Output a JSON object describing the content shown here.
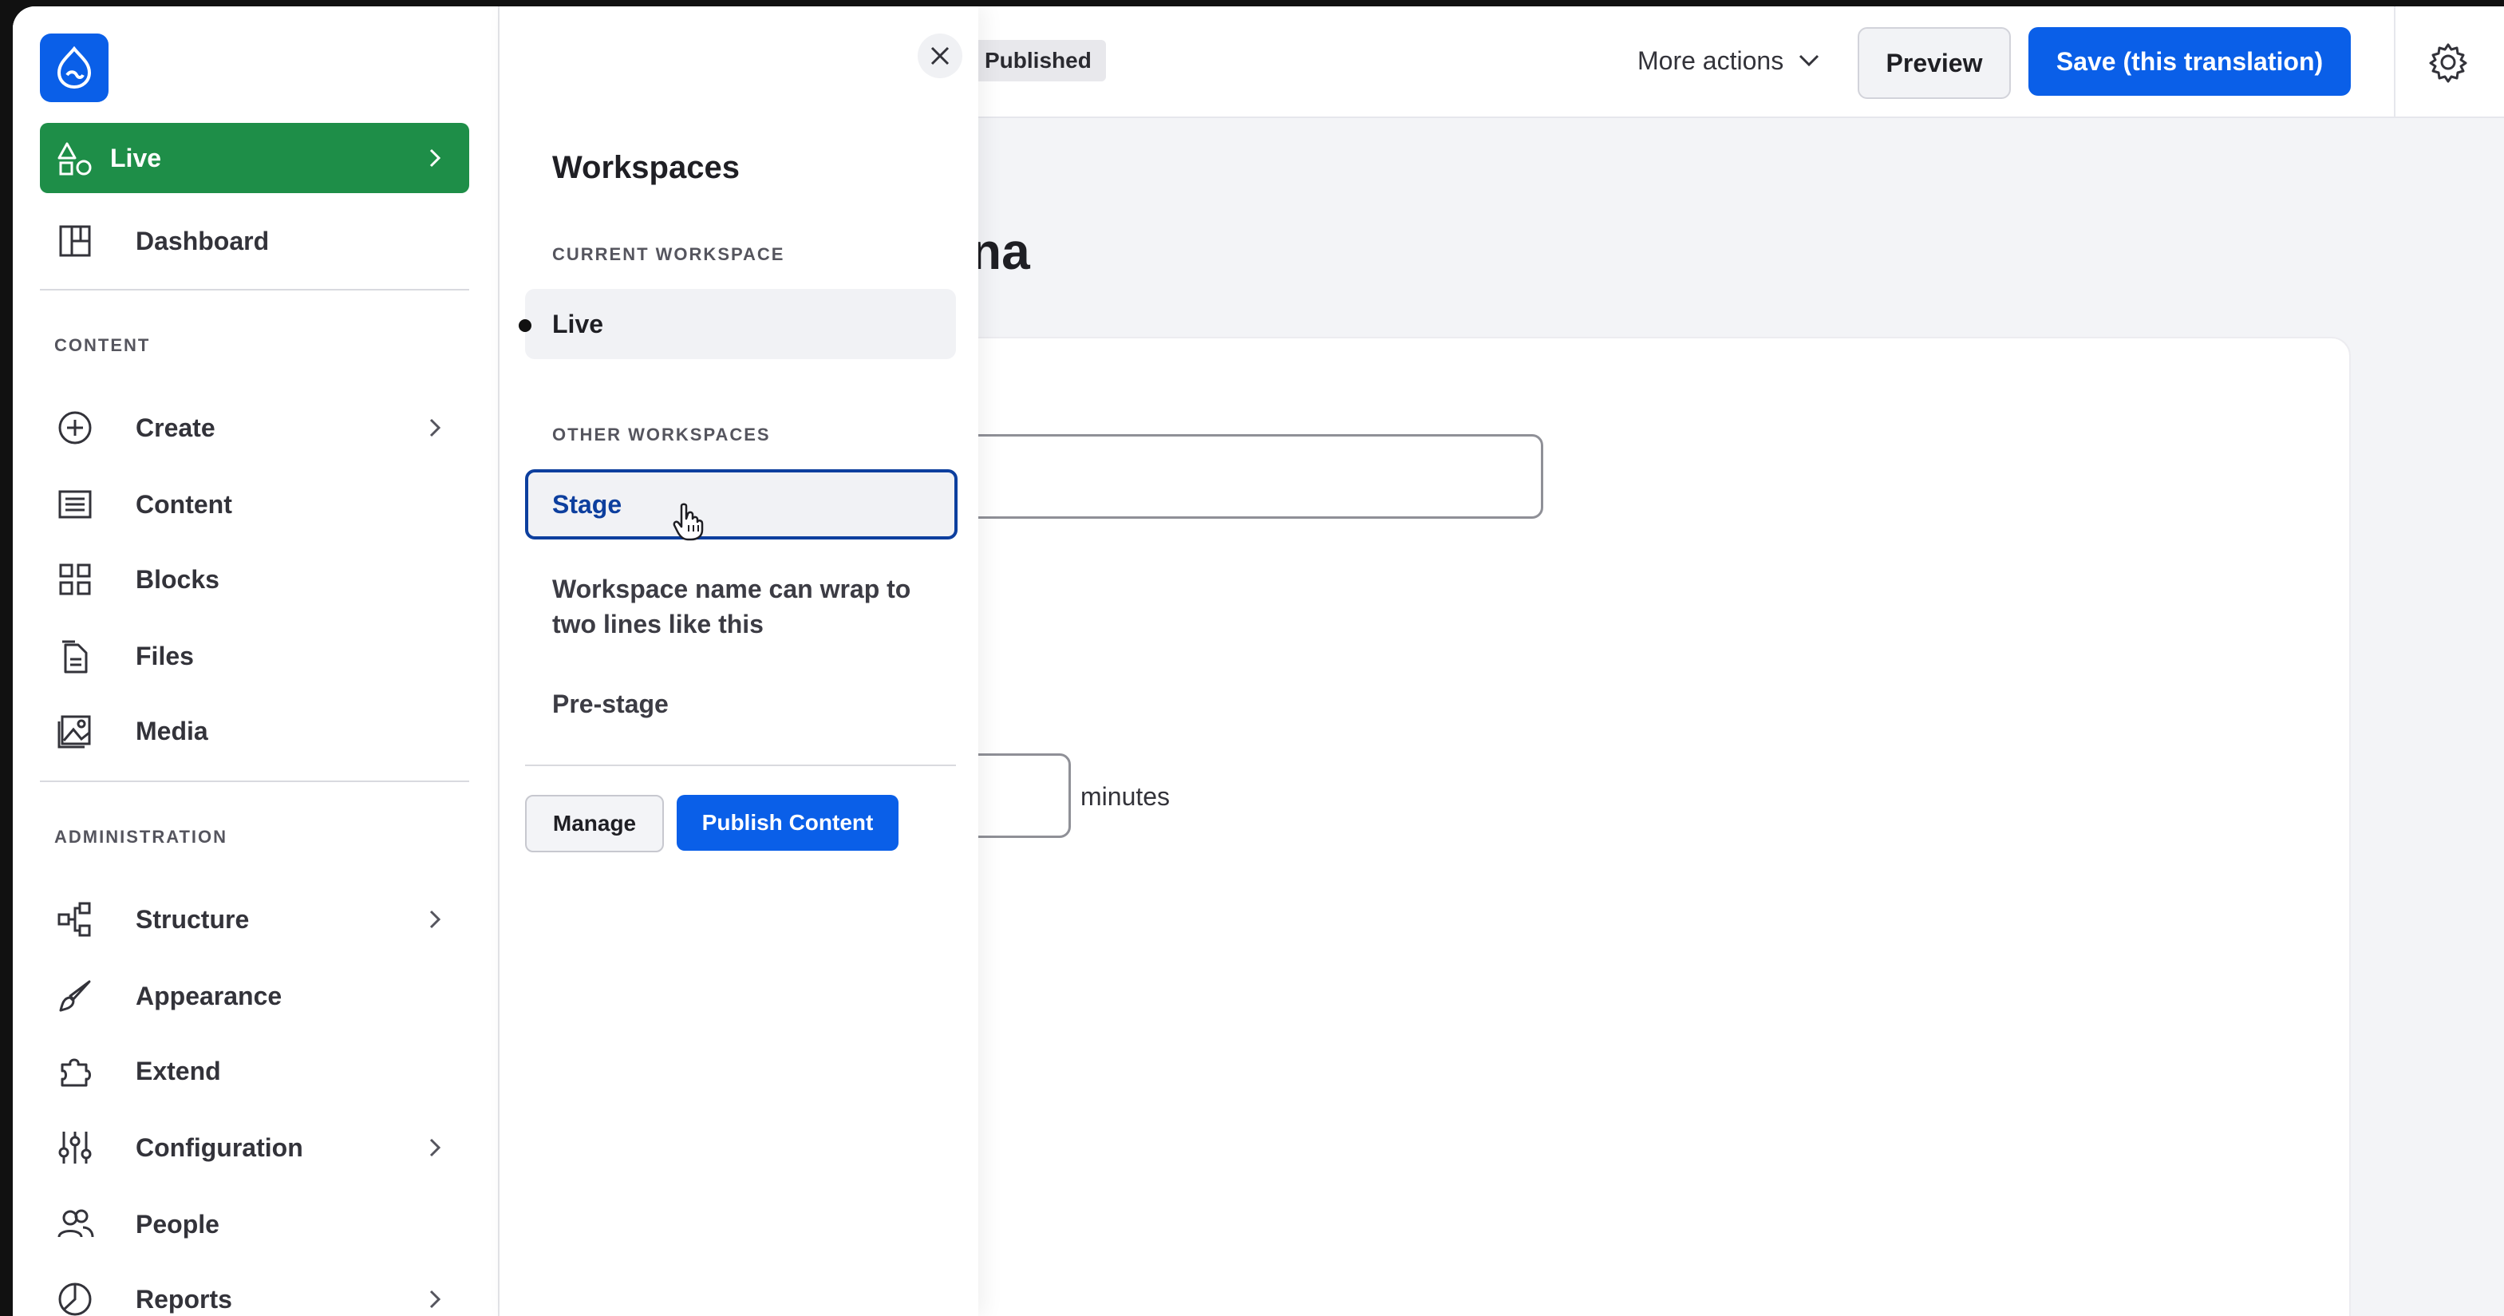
{
  "toolbar": {
    "status_badge": "Published",
    "more_actions": "More actions",
    "preview": "Preview",
    "save": "Save (this translation)"
  },
  "main": {
    "title_fragment": "na",
    "field_suffix": "minutes"
  },
  "sidebar": {
    "workspace_button": "Live",
    "dashboard": "Dashboard",
    "content_section": "CONTENT",
    "admin_section": "ADMINISTRATION",
    "content_items": [
      {
        "label": "Create",
        "icon": "plus-circle-icon",
        "has_submenu": true
      },
      {
        "label": "Content",
        "icon": "content-list-icon",
        "has_submenu": false
      },
      {
        "label": "Blocks",
        "icon": "blocks-grid-icon",
        "has_submenu": false
      },
      {
        "label": "Files",
        "icon": "file-icon",
        "has_submenu": false
      },
      {
        "label": "Media",
        "icon": "media-image-icon",
        "has_submenu": false
      }
    ],
    "admin_items": [
      {
        "label": "Structure",
        "icon": "structure-icon",
        "has_submenu": true
      },
      {
        "label": "Appearance",
        "icon": "paintbrush-icon",
        "has_submenu": false
      },
      {
        "label": "Extend",
        "icon": "puzzle-icon",
        "has_submenu": false
      },
      {
        "label": "Configuration",
        "icon": "sliders-icon",
        "has_submenu": true
      },
      {
        "label": "People",
        "icon": "people-icon",
        "has_submenu": false
      },
      {
        "label": "Reports",
        "icon": "pie-chart-icon",
        "has_submenu": true
      }
    ]
  },
  "workspaces_panel": {
    "title": "Workspaces",
    "current_label": "CURRENT WORKSPACE",
    "current": "Live",
    "other_label": "OTHER WORKSPACES",
    "others": [
      "Stage",
      "Workspace name can wrap to two lines like this",
      "Pre-stage"
    ],
    "manage": "Manage",
    "publish": "Publish Content"
  },
  "colors": {
    "accent": "#0a5fe8",
    "live_green": "#1e8e48",
    "selected_border": "#0d3f9e"
  }
}
